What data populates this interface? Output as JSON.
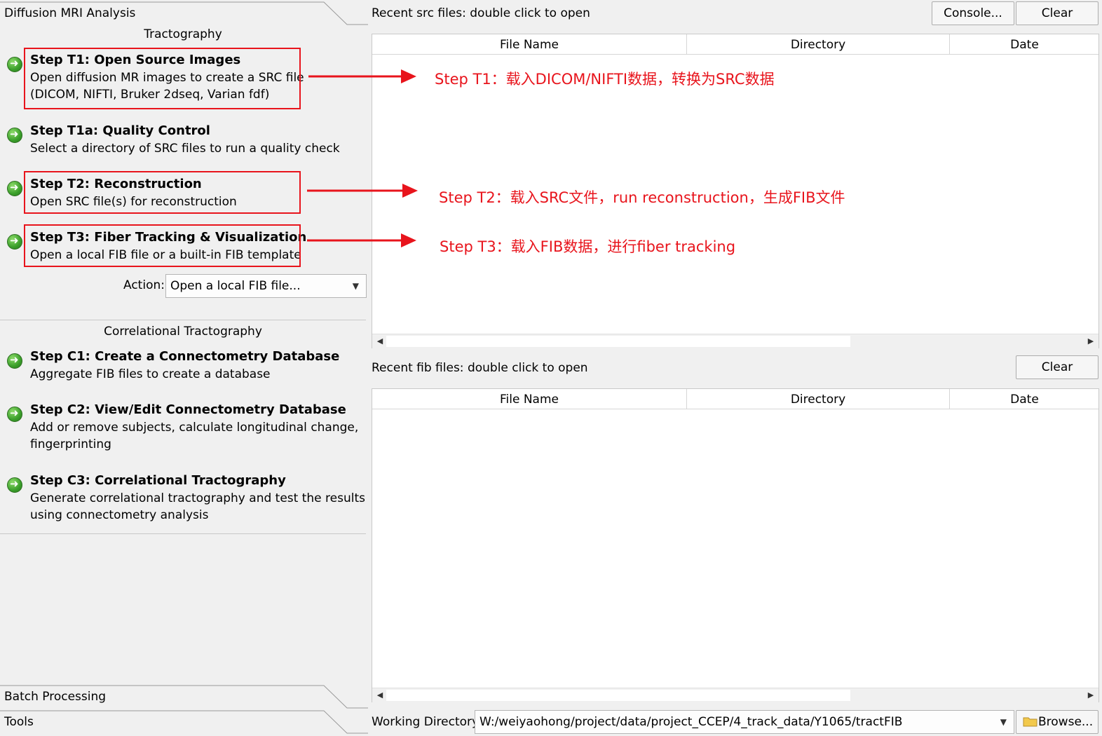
{
  "left_panel": {
    "tabs": {
      "diffusion": "Diffusion MRI Analysis",
      "batch": "Batch Processing",
      "tools": "Tools"
    },
    "tractography": {
      "title": "Tractography",
      "steps": [
        {
          "title": "Step T1: Open Source Images",
          "desc1": "Open diffusion MR images to create a SRC file",
          "desc2": "(DICOM, NIFTI, Bruker 2dseq, Varian fdf)"
        },
        {
          "title": "Step T1a: Quality Control",
          "desc1": "Select a directory of SRC files to run a quality check",
          "desc2": ""
        },
        {
          "title": "Step T2: Reconstruction",
          "desc1": "Open SRC file(s) for reconstruction",
          "desc2": ""
        },
        {
          "title": "Step T3: Fiber Tracking & Visualization",
          "desc1": "Open a local FIB file or a built-in FIB template",
          "desc2": ""
        }
      ],
      "action_label": "Action:",
      "action_value": "Open a local FIB file..."
    },
    "correlational": {
      "title": "Correlational Tractography",
      "steps": [
        {
          "title": "Step C1: Create a Connectometry Database",
          "desc1": "Aggregate FIB files to create a database",
          "desc2": ""
        },
        {
          "title": "Step C2: View/Edit Connectometry Database",
          "desc1": "Add or remove subjects, calculate longitudinal change,",
          "desc2": "fingerprinting"
        },
        {
          "title": "Step C3: Correlational Tractography",
          "desc1": "Generate correlational tractography and test the results",
          "desc2": "using connectometry analysis"
        }
      ]
    }
  },
  "src_panel": {
    "label": "Recent src files: double click to open",
    "console_button": "Console...",
    "clear_button": "Clear",
    "columns": [
      "File Name",
      "Directory",
      "Date"
    ]
  },
  "fib_panel": {
    "label": "Recent fib files: double click to open",
    "clear_button": "Clear",
    "columns": [
      "File Name",
      "Directory",
      "Date"
    ]
  },
  "working_directory": {
    "label": "Working Directory",
    "value": "W:/weiyaohong/project/data/project_CCEP/4_track_data/Y1065/tractFIB",
    "browse_button": "Browse..."
  },
  "annotations": {
    "t1": "Step T1：载入DICOM/NIFTI数据，转换为SRC数据",
    "t2": "Step T2：载入SRC文件，run reconstruction，生成FIB文件",
    "t3": "Step T3：载入FIB数据，进行fiber tracking"
  },
  "colors": {
    "annotation_red": "#e8141c",
    "panel_bg": "#f0f0f0",
    "step_icon_green": "#3a9e2a"
  }
}
